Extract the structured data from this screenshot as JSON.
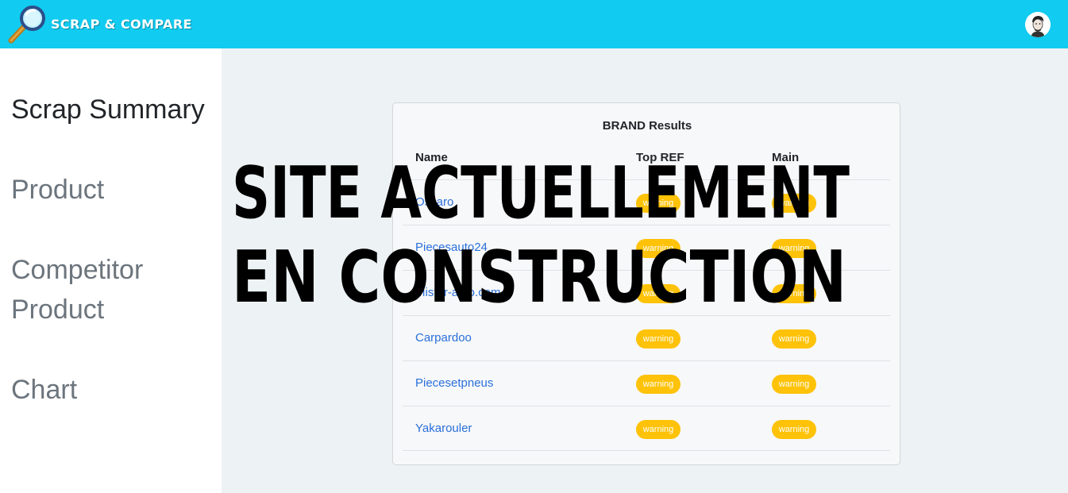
{
  "header": {
    "brand": "SCRAP & COMPARE",
    "logo_icon": "magnifier-icon",
    "avatar_icon": "user-avatar-icon",
    "background_color": "#11cbf0"
  },
  "sidebar": {
    "items": [
      {
        "label": "Scrap Summary",
        "active": true
      },
      {
        "label": "Product",
        "active": false
      },
      {
        "label": "Competitor Product",
        "active": false
      },
      {
        "label": "Chart",
        "active": false
      }
    ]
  },
  "card": {
    "title": "BRAND Results",
    "columns": [
      "Name",
      "Top REF",
      "Main"
    ],
    "rows": [
      {
        "name": "Oscaro",
        "top_ref": "warning",
        "main": "warning"
      },
      {
        "name": "Piecesauto24",
        "top_ref": "warning",
        "main": "warning"
      },
      {
        "name": "Mister-auto.com",
        "top_ref": "warning",
        "main": "warning"
      },
      {
        "name": "Carpardoo",
        "top_ref": "warning",
        "main": "warning"
      },
      {
        "name": "Piecesetpneus",
        "top_ref": "warning",
        "main": "warning"
      },
      {
        "name": "Yakarouler",
        "top_ref": "warning",
        "main": "warning"
      }
    ],
    "badge_color": "#fec208"
  },
  "overlay": {
    "line1": "SITE ACTUELLEMENT",
    "line2": "EN CONSTRUCTION"
  }
}
